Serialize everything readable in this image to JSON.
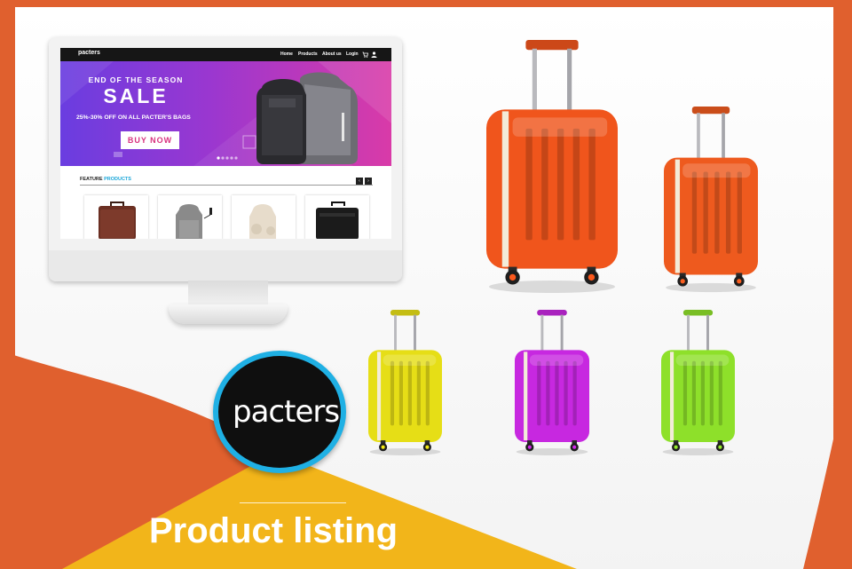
{
  "brand": {
    "name": "pacters"
  },
  "monitor_site": {
    "logo": "pacters",
    "nav": [
      "Home",
      "Products",
      "About us",
      "Login"
    ],
    "hero": {
      "kicker": "END OF THE SEASON",
      "headline": "SALE",
      "offer": "25%-30% OFF ON ALL PACTER'S BAGS",
      "cta": "BUY NOW"
    },
    "feature_section": {
      "title_prefix": "FEATURE ",
      "title_highlight": "PRODUCTS",
      "prev": "‹",
      "next": "›"
    },
    "products": [
      "laptop-bag-brown",
      "backpack-grey",
      "backpack-beige",
      "laptop-bag-black"
    ]
  },
  "suitcases": [
    {
      "color": "#f0551c",
      "size": "large"
    },
    {
      "color": "#ee5a1e",
      "size": "medium"
    },
    {
      "color": "#e6de16",
      "size": "small"
    },
    {
      "color": "#c728e0",
      "size": "small"
    },
    {
      "color": "#8ee02a",
      "size": "small"
    }
  ],
  "caption": {
    "label": "Product listing"
  },
  "colors": {
    "orange": "#e0602e",
    "yellow": "#f2b51a",
    "badge_ring": "#1fb0e4",
    "hero_pink": "#d8327f",
    "hero_purple": "#6a3de0"
  }
}
